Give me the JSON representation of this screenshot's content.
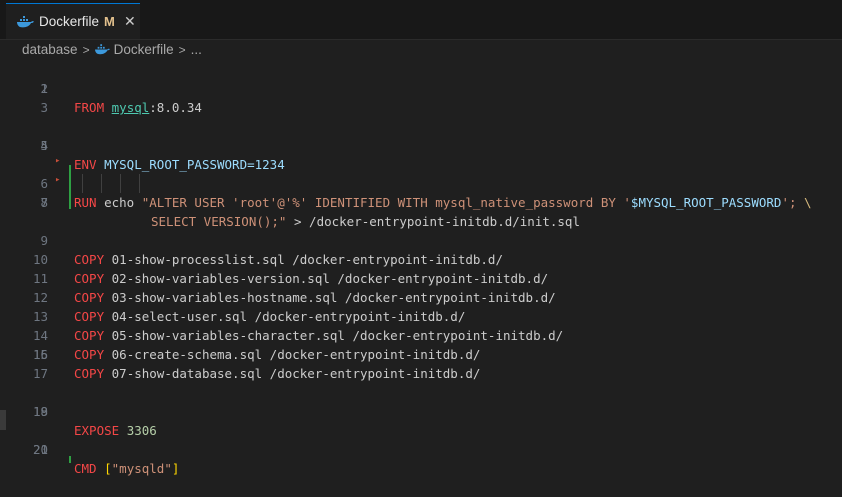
{
  "tab": {
    "title": "Dockerfile",
    "modified": "M",
    "close": "✕"
  },
  "breadcrumb": {
    "folder": "database",
    "file": "Dockerfile",
    "more": "..."
  },
  "colors": {
    "accent": "#0078d4",
    "added": "#2ea043",
    "keyword": "#f44747",
    "string": "#ce9178"
  },
  "lines": [
    {
      "n": "1"
    },
    {
      "n": "2"
    },
    {
      "n": "3"
    },
    {
      "n": "4"
    },
    {
      "n": "5"
    },
    {
      "n": "6"
    },
    {
      "n": "7"
    },
    {
      "n": "8"
    },
    {
      "n": "9"
    },
    {
      "n": "10"
    },
    {
      "n": "11"
    },
    {
      "n": "12"
    },
    {
      "n": "13"
    },
    {
      "n": "14"
    },
    {
      "n": "15"
    },
    {
      "n": "16"
    },
    {
      "n": "17"
    },
    {
      "n": "18"
    },
    {
      "n": "19"
    },
    {
      "n": "20"
    },
    {
      "n": "21"
    }
  ],
  "code": {
    "l1": {
      "kw": "FROM",
      "image": "mysql",
      "tag": ":8.0.34"
    },
    "l4": {
      "kw": "ENV",
      "rest": "MYSQL_ROOT_PASSWORD=1234"
    },
    "l6": {
      "kw": "RUN",
      "cmd": "echo",
      "str1": "\"ALTER USER 'root'@'%' IDENTIFIED WITH mysql_native_password BY '",
      "var": "$MYSQL_ROOT_PASSWORD",
      "str2": "';",
      "esc": "\\"
    },
    "l7": {
      "str": "SELECT VERSION();\"",
      "rest": "> /docker-entrypoint-initdb.d/init.sql"
    },
    "copies": [
      {
        "kw": "COPY",
        "rest": "01-show-processlist.sql /docker-entrypoint-initdb.d/"
      },
      {
        "kw": "COPY",
        "rest": "02-show-variables-version.sql /docker-entrypoint-initdb.d/"
      },
      {
        "kw": "COPY",
        "rest": "03-show-variables-hostname.sql /docker-entrypoint-initdb.d/"
      },
      {
        "kw": "COPY",
        "rest": "04-select-user.sql /docker-entrypoint-initdb.d/"
      },
      {
        "kw": "COPY",
        "rest": "05-show-variables-character.sql /docker-entrypoint-initdb.d/"
      },
      {
        "kw": "COPY",
        "rest": "06-create-schema.sql /docker-entrypoint-initdb.d/"
      },
      {
        "kw": "COPY",
        "rest": "07-show-database.sql /docker-entrypoint-initdb.d/"
      }
    ],
    "l18": {
      "kw": "EXPOSE",
      "port": "3306"
    },
    "l20": {
      "kw": "CMD",
      "open": "[",
      "str": "\"mysqld\"",
      "close": "]"
    }
  }
}
